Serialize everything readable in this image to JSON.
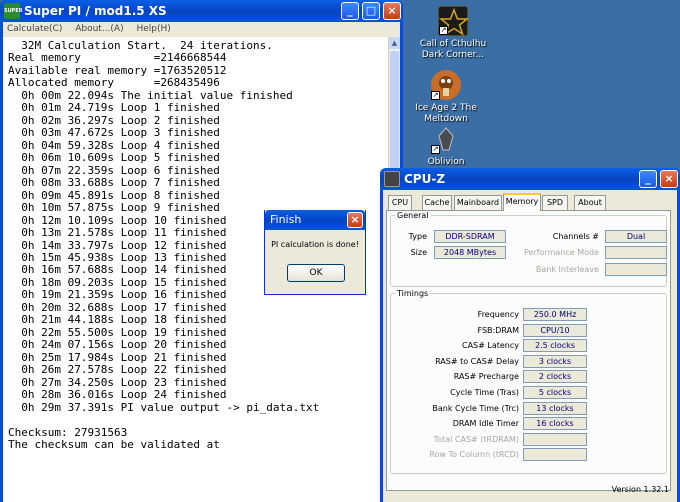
{
  "desktop": {
    "icons": [
      {
        "label": "Call of Cthulhu Dark Corner...",
        "line1": "Call of Cthulhu",
        "line2": "Dark Corner..."
      },
      {
        "label": "Ice Age 2 The Meltdown",
        "line1": "Ice Age 2 The",
        "line2": "Meltdown"
      },
      {
        "label": "Oblivion",
        "line1": "Oblivion",
        "line2": ""
      }
    ]
  },
  "superpi": {
    "title": "Super PI / mod1.5 XS",
    "icon_text": "SUPER",
    "menu": [
      "Calculate(C)",
      "About...(A)",
      "Help(H)"
    ],
    "console_lines": [
      "  32M Calculation Start.  24 iterations.",
      "Real memory           =2146668544",
      "Available real memory =1763520512",
      "Allocated memory      =268435496",
      "  0h 00m 22.094s The initial value finished",
      "  0h 01m 24.719s Loop 1 finished",
      "  0h 02m 36.297s Loop 2 finished",
      "  0h 03m 47.672s Loop 3 finished",
      "  0h 04m 59.328s Loop 4 finished",
      "  0h 06m 10.609s Loop 5 finished",
      "  0h 07m 22.359s Loop 6 finished",
      "  0h 08m 33.688s Loop 7 finished",
      "  0h 09m 45.891s Loop 8 finished",
      "  0h 10m 57.875s Loop 9 finished",
      "  0h 12m 10.109s Loop 10 finished",
      "  0h 13m 21.578s Loop 11 finished",
      "  0h 14m 33.797s Loop 12 finished",
      "  0h 15m 45.938s Loop 13 finished",
      "  0h 16m 57.688s Loop 14 finished",
      "  0h 18m 09.203s Loop 15 finished",
      "  0h 19m 21.359s Loop 16 finished",
      "  0h 20m 32.688s Loop 17 finished",
      "  0h 21m 44.188s Loop 18 finished",
      "  0h 22m 55.500s Loop 19 finished",
      "  0h 24m 07.156s Loop 20 finished",
      "  0h 25m 17.984s Loop 21 finished",
      "  0h 26m 27.578s Loop 22 finished",
      "  0h 27m 34.250s Loop 23 finished",
      "  0h 28m 36.016s Loop 24 finished",
      "  0h 29m 37.391s PI value output -> pi_data.txt",
      "",
      "Checksum: 27931563",
      "The checksum can be validated at"
    ]
  },
  "finish_dialog": {
    "title": "Finish",
    "message": "PI calculation is done!",
    "ok_label": "OK"
  },
  "cpuz": {
    "title": "CPU-Z",
    "tabs": [
      "CPU",
      "Cache",
      "Mainboard",
      "Memory",
      "SPD",
      "About"
    ],
    "active_tab": "Memory",
    "general": {
      "legend": "General",
      "type_label": "Type",
      "type_value": "DDR-SDRAM",
      "size_label": "Size",
      "size_value": "2048 MBytes",
      "channels_label": "Channels #",
      "channels_value": "Dual",
      "perf_mode_label": "Performance Mode",
      "perf_mode_value": "",
      "bank_interleave_label": "Bank Interleave",
      "bank_interleave_value": ""
    },
    "timings": {
      "legend": "Timings",
      "rows": [
        {
          "label": "Frequency",
          "value": "250.0 MHz",
          "dim": false
        },
        {
          "label": "FSB:DRAM",
          "value": "CPU/10",
          "dim": false
        },
        {
          "label": "CAS# Latency",
          "value": "2.5 clocks",
          "dim": false
        },
        {
          "label": "RAS# to CAS# Delay",
          "value": "3 clocks",
          "dim": false
        },
        {
          "label": "RAS# Precharge",
          "value": "2 clocks",
          "dim": false
        },
        {
          "label": "Cycle Time (Tras)",
          "value": "5 clocks",
          "dim": false
        },
        {
          "label": "Bank Cycle Time (Trc)",
          "value": "13 clocks",
          "dim": false
        },
        {
          "label": "DRAM Idle Timer",
          "value": "16 clocks",
          "dim": false
        },
        {
          "label": "Total CAS# (tRDRAM)",
          "value": "",
          "dim": true
        },
        {
          "label": "Row To Column (tRCD)",
          "value": "",
          "dim": true
        }
      ]
    },
    "version": "Version 1.32.1"
  },
  "colors": {
    "desktop": "#3a6ea5",
    "titlebar": "#0a55d8",
    "value_text": "#00007d"
  }
}
